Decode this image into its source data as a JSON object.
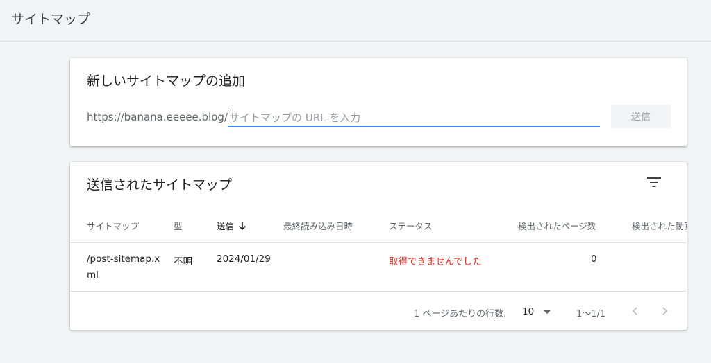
{
  "page": {
    "title": "サイトマップ"
  },
  "add_sitemap": {
    "title": "新しいサイトマップの追加",
    "url_prefix": "https://banana.eeeee.blog/",
    "input_value": "",
    "input_placeholder": "サイトマップの URL を入力",
    "submit_label": "送信"
  },
  "submitted": {
    "title": "送信されたサイトマップ",
    "filter_icon": "filter-list-icon",
    "columns": {
      "sitemap": "サイトマップ",
      "type": "型",
      "submitted": "送信",
      "last_read": "最終読み込み日時",
      "status": "ステータス",
      "pages_found": "検出されたページ数",
      "videos_found": "検出された動画"
    },
    "sort_icon": "arrow-downward-icon",
    "rows": [
      {
        "sitemap": "/post-sitemap.x\nml",
        "sitemap_line1": "/post-sitemap.x",
        "sitemap_line2": "ml",
        "type": "不明",
        "submitted": "2024/01/29",
        "last_read": "",
        "status": "取得できませんでした",
        "pages_found": "0",
        "videos_found": ""
      }
    ],
    "footer": {
      "rows_per_page_label": "1 ページあたりの行数:",
      "rows_per_page_value": "10",
      "range": "1〜1/1"
    }
  },
  "colors": {
    "accent": "#4285f4",
    "error": "#d93025",
    "background": "#f1f3f4"
  }
}
